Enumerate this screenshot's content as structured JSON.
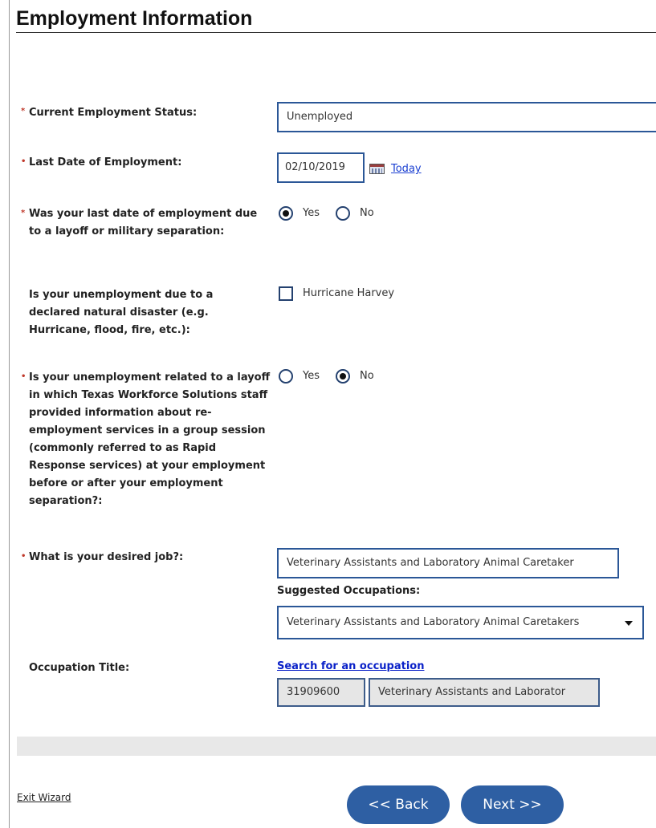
{
  "page": {
    "title": "Employment Information"
  },
  "employment_status": {
    "label": "Current Employment Status:",
    "value": "Unemployed"
  },
  "last_date": {
    "label": "Last Date of Employment:",
    "value": "02/10/2019",
    "today_link": "Today"
  },
  "layoff_question": {
    "label": "Was your last date of employment due to a layoff or military separation:",
    "yes_label": "Yes",
    "no_label": "No",
    "selected": "Yes"
  },
  "disaster_question": {
    "label": "Is your unemployment due to a declared natural disaster (e.g. Hurricane, flood, fire, etc.):",
    "checkbox_label": "Hurricane Harvey",
    "checked": false
  },
  "rapid_response_question": {
    "label": "Is your unemployment related to a layoff in which Texas Workforce Solutions staff provided information about re-employment services in a group session (commonly referred to as Rapid Response services) at your employment before or after your employment separation?:",
    "yes_label": "Yes",
    "no_label": "No",
    "selected": "No"
  },
  "desired_job": {
    "label": "What is your desired job?:",
    "value": "Veterinary Assistants and Laboratory Animal Caretaker",
    "suggested_label": "Suggested Occupations:",
    "suggested_selected": "Veterinary Assistants and Laboratory Animal Caretakers"
  },
  "occupation": {
    "label": "Occupation Title:",
    "search_link": "Search for an occupation",
    "code": "31909600",
    "title": "Veterinary Assistants and Laborator"
  },
  "footer": {
    "exit_label": "Exit Wizard",
    "back_label": "<< Back",
    "next_label": "Next >>"
  },
  "colors": {
    "accent": "#2e5fa3",
    "field_border": "#2b5797",
    "required_marker": "#c0392b",
    "link": "#1a3fd1"
  }
}
